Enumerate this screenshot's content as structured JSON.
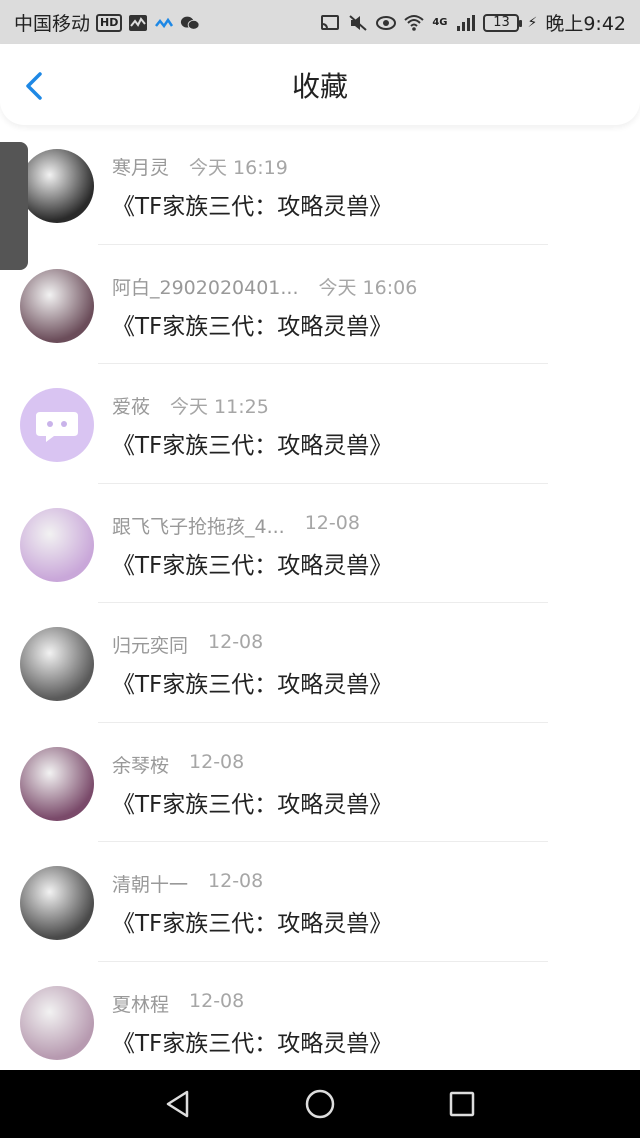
{
  "status_bar": {
    "carrier": "中国移动",
    "hd_badge": "HD",
    "battery": "13",
    "time": "晚上9:42",
    "network": "4G"
  },
  "header": {
    "title": "收藏",
    "back_icon": "chevron-left-icon"
  },
  "favorites": [
    {
      "user": "寒月灵",
      "time": "今天 16:19",
      "title": "《TF家族三代：攻略灵兽》",
      "avatar_color": "#2a2a2a"
    },
    {
      "user": "阿白_2902020401...",
      "time": "今天 16:06",
      "title": "《TF家族三代：攻略灵兽》",
      "avatar_color": "#6b4d5a"
    },
    {
      "user": "爱莜",
      "time": "今天 11:25",
      "title": "《TF家族三代：攻略灵兽》",
      "avatar_color": "#d9c4f2"
    },
    {
      "user": "跟飞飞子抢拖孩_4...",
      "time": "12-08",
      "title": "《TF家族三代：攻略灵兽》",
      "avatar_color": "#c9a7d9"
    },
    {
      "user": "归元奕同",
      "time": "12-08",
      "title": "《TF家族三代：攻略灵兽》",
      "avatar_color": "#5a5a5a"
    },
    {
      "user": "余琴桉",
      "time": "12-08",
      "title": "《TF家族三代：攻略灵兽》",
      "avatar_color": "#7a4a6a"
    },
    {
      "user": "清朝十一",
      "time": "12-08",
      "title": "《TF家族三代：攻略灵兽》",
      "avatar_color": "#4a4a4a"
    },
    {
      "user": "夏林程",
      "time": "12-08",
      "title": "《TF家族三代：攻略灵兽》",
      "avatar_color": "#b79ab0"
    }
  ],
  "colors": {
    "accent": "#1e88e5",
    "status_bar_bg": "#dcdcdc",
    "nav_bar_bg": "#000000"
  }
}
